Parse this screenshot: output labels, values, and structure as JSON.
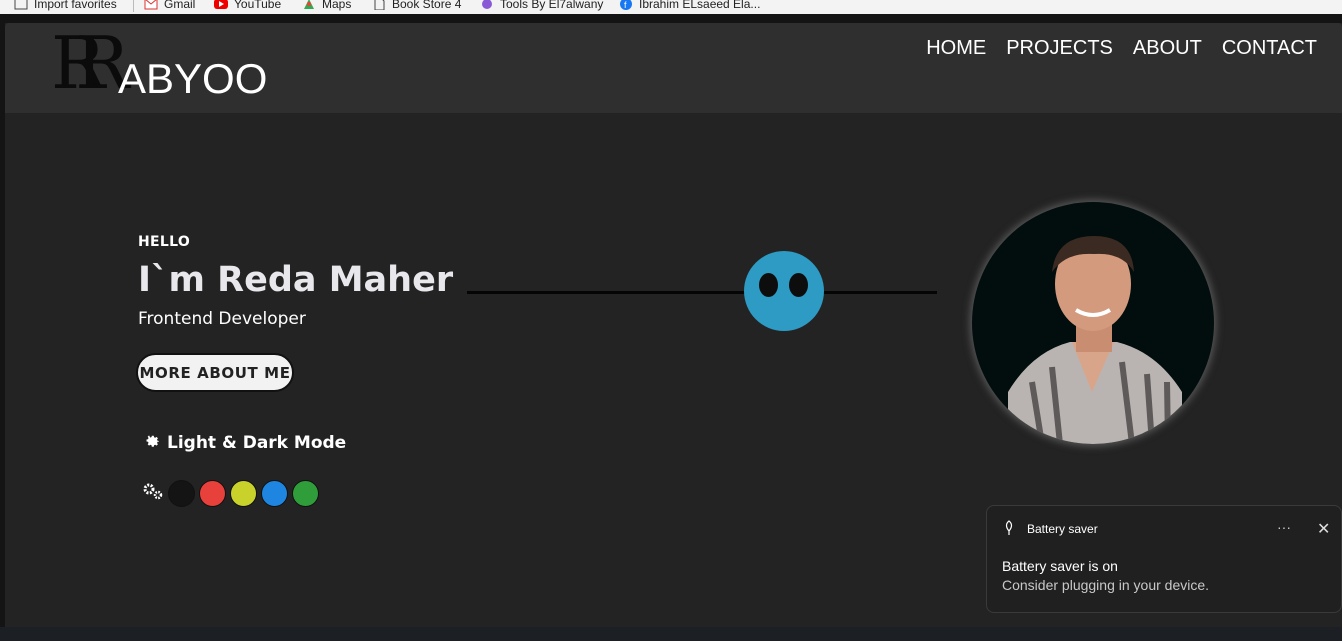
{
  "browser": {
    "bookmarks": [
      {
        "label": "Import favorites",
        "icon": "import-icon"
      },
      {
        "label": "Gmail",
        "icon": "gmail-icon"
      },
      {
        "label": "YouTube",
        "icon": "youtube-icon"
      },
      {
        "label": "Maps",
        "icon": "maps-icon"
      },
      {
        "label": "Book Store 4",
        "icon": "page-icon"
      },
      {
        "label": "Tools By El7alwany",
        "icon": "tools-icon"
      },
      {
        "label": "Ibrahim ELsaeed Ela...",
        "icon": "facebook-icon"
      }
    ]
  },
  "header": {
    "logo_mark": "RR",
    "logo_text": "ABYOO",
    "nav": [
      "HOME",
      "PROJECTS",
      "ABOUT",
      "CONTACT"
    ]
  },
  "hero": {
    "greeting": "HELLO",
    "name": "I`m Reda Maher",
    "role": "Frontend Developer",
    "cta": "MORE ABOUT ME",
    "mode_label": "Light & Dark Mode",
    "palette": [
      "#141414",
      "#e8403a",
      "#c9d22a",
      "#1e86e0",
      "#2f9e3a"
    ],
    "accent": "#2e9bc4"
  },
  "toast": {
    "app": "Battery saver",
    "title": "Battery saver is on",
    "body": "Consider plugging in your device.",
    "more": "···",
    "close": "✕"
  }
}
